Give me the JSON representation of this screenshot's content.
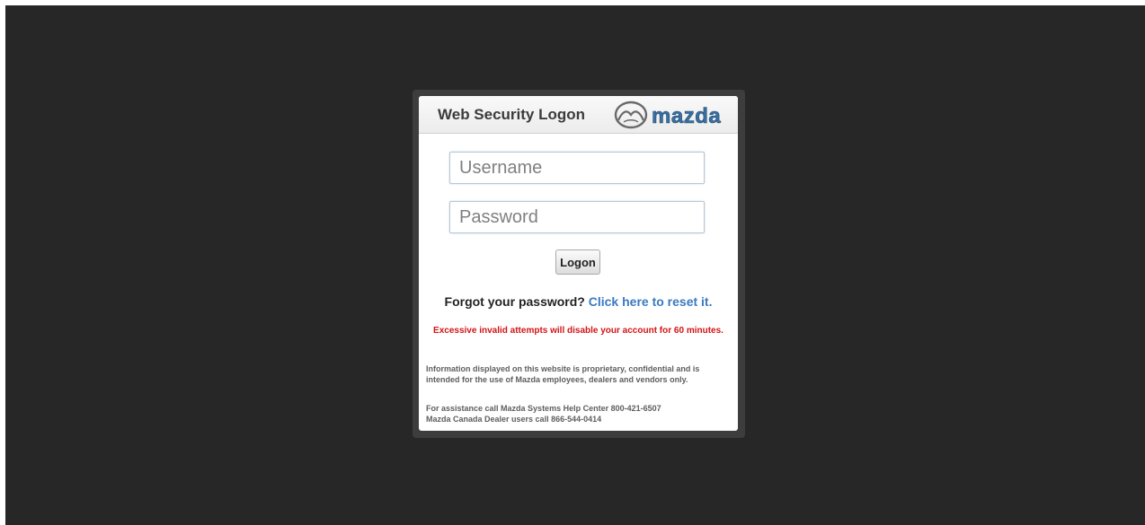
{
  "header": {
    "title": "Web Security Logon",
    "logo_text": "mazda"
  },
  "form": {
    "username_placeholder": "Username",
    "username_value": "",
    "password_placeholder": "Password",
    "password_value": "",
    "logon_label": "Logon"
  },
  "forgot": {
    "prompt": "Forgot your password?",
    "link_text": "Click here to reset it."
  },
  "warning": "Excessive invalid attempts will disable your account for 60 minutes.",
  "disclaimer": {
    "line1": "Information displayed on this website is proprietary, confidential and is",
    "line2": "intended for the use of Mazda employees, dealers and vendors only."
  },
  "support": {
    "line1": "For assistance call Mazda Systems Help Center 800-421-6507",
    "line2": "Mazda Canada Dealer users call 866-544-0414"
  },
  "colors": {
    "background": "#272727",
    "link": "#3a7ac0",
    "warning": "#d41313",
    "logo": "#3c6f9e"
  }
}
